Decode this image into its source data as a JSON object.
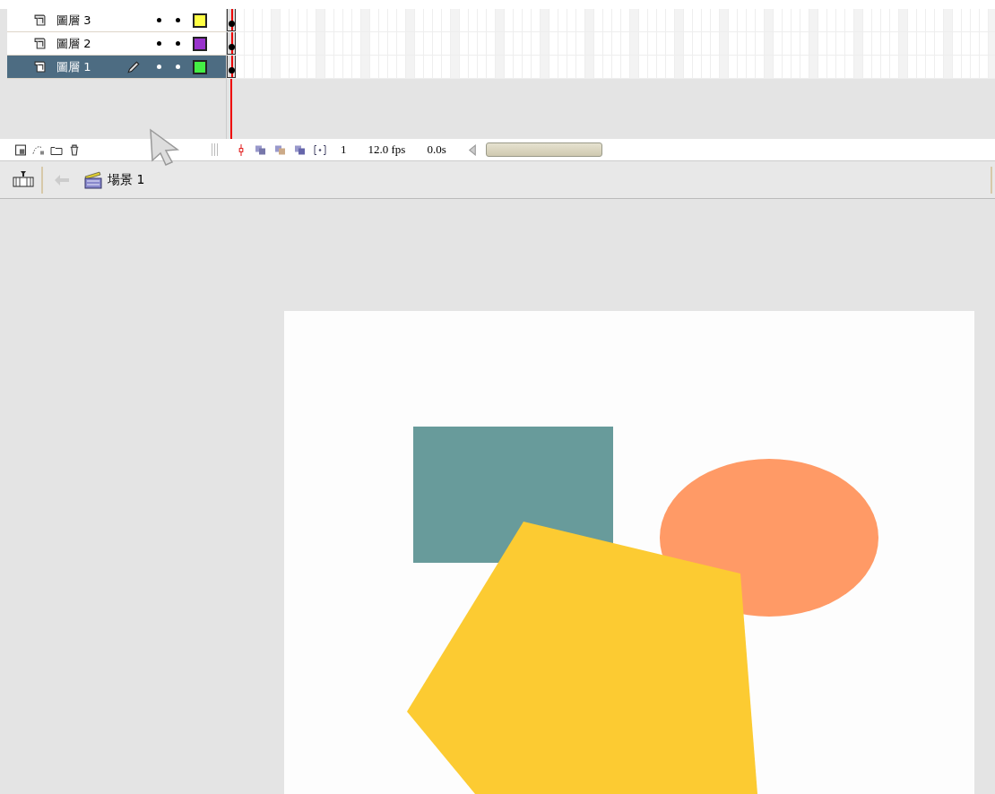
{
  "layers": [
    {
      "name": "圖層 3",
      "selected": false,
      "color": "#ffff44"
    },
    {
      "name": "圖層 2",
      "selected": false,
      "color": "#9933cc"
    },
    {
      "name": "圖層 1",
      "selected": true,
      "color": "#44ee44"
    }
  ],
  "timeline_status": {
    "frame": "1",
    "fps": "12.0 fps",
    "time": "0.0s"
  },
  "edit_bar": {
    "scene": "場景 1"
  }
}
